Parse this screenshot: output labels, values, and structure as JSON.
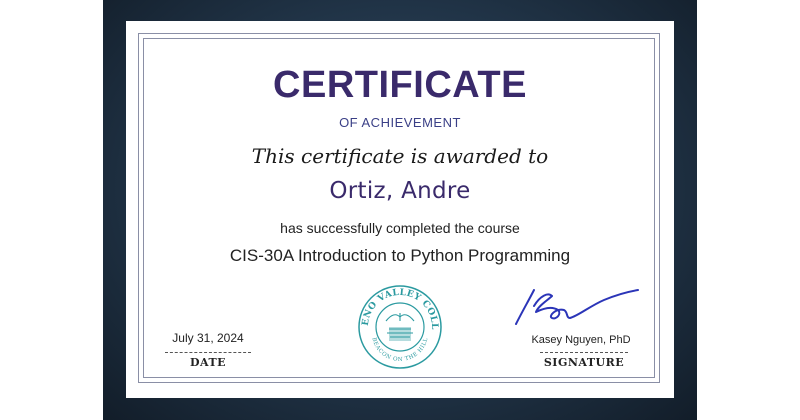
{
  "certificate": {
    "title": "CERTIFICATE",
    "subtitle": "OF ACHIEVEMENT",
    "awarded_text": "This certificate is awarded to",
    "recipient": "Ortiz, Andre",
    "completed_text": "has successfully completed the course",
    "course": "CIS-30A Introduction to Python Programming",
    "date_value": "July 31, 2024",
    "date_label": "DATE",
    "signer_name": "Kasey Nguyen, PhD",
    "signature_label": "SIGNATURE",
    "seal_text": "MORENO VALLEY COLLEGE",
    "seal_motto": "BEACON ON THE HILL"
  },
  "colors": {
    "title": "#3a2a6b",
    "subtitle": "#3a3f86",
    "seal": "#2b9aa0",
    "signature_ink": "#2b35b8",
    "frame": "#1c2c3c"
  },
  "icons": {
    "seal": "college-seal-icon",
    "signature": "signature-icon"
  }
}
